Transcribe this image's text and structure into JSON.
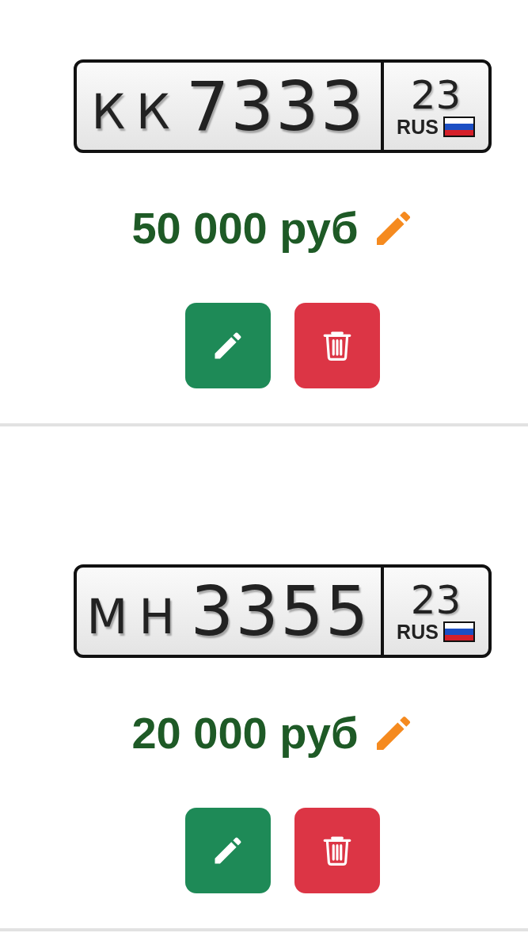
{
  "listings": [
    {
      "plate": {
        "letters": "КК",
        "digits": "7333",
        "region": "23",
        "country": "RUS"
      },
      "price": "50 000 руб"
    },
    {
      "plate": {
        "letters": "МН",
        "digits": "3355",
        "region": "23",
        "country": "RUS"
      },
      "price": "20 000 руб"
    }
  ]
}
